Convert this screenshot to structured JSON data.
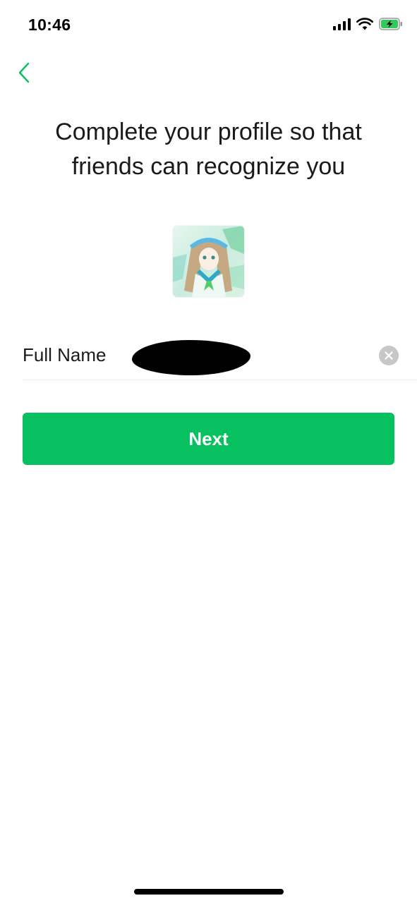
{
  "status_bar": {
    "time": "10:46",
    "icons": [
      "signal-icon",
      "wifi-icon",
      "battery-charging-icon"
    ]
  },
  "nav": {
    "back_icon": "chevron-left-icon"
  },
  "title": {
    "line1": "Complete your profile so that",
    "line2": "friends can recognize you"
  },
  "form": {
    "name_label": "Full Name",
    "name_value": "",
    "name_redacted": true,
    "clear_icon": "clear-x-icon"
  },
  "actions": {
    "next_label": "Next"
  },
  "colors": {
    "accent": "#07c160",
    "back_icon": "#07c160",
    "battery_fill": "#34c759",
    "clear_button": "#c7c7c7",
    "divider": "#ececec"
  }
}
